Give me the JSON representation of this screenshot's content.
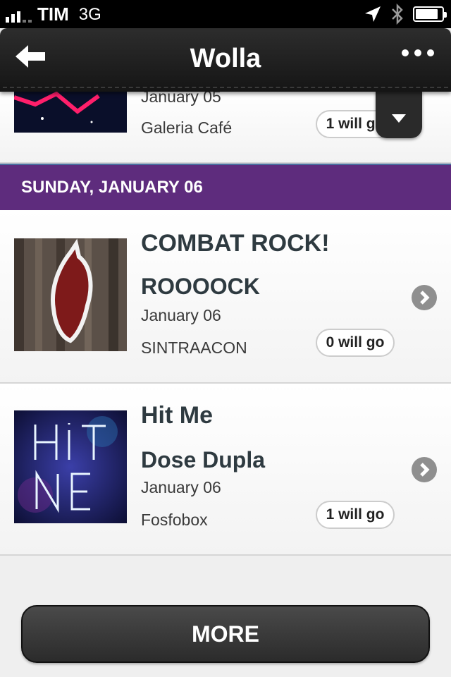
{
  "statusbar": {
    "carrier": "TIM",
    "network": "3G",
    "icons": [
      "signal-bars",
      "location-arrow-icon",
      "bluetooth-icon",
      "battery-icon"
    ],
    "battery_level": 0.85
  },
  "navbar": {
    "title": "Wolla",
    "back_icon": "back-arrow-icon",
    "menu_icon": "more-dots-icon"
  },
  "colors": {
    "day_header": "#5e2c7d",
    "navbar": "#1f1f1f",
    "title_text": "#2e3a40"
  },
  "partial_event": {
    "date": "January 05",
    "venue": "Galeria Café",
    "attendance": "1 will go"
  },
  "day_header": {
    "label": "SUNDAY, JANUARY 06"
  },
  "events": [
    {
      "title": "COMBAT ROCK!",
      "subtitle": "ROOOOCK",
      "date": "January 06",
      "venue": "SINTRAACON",
      "attendance": "0 will go"
    },
    {
      "title": "Hit Me",
      "subtitle": "Dose Dupla",
      "date": "January 06",
      "venue": "Fosfobox",
      "attendance": "1 will go"
    }
  ],
  "more_button": {
    "label": "MORE"
  }
}
